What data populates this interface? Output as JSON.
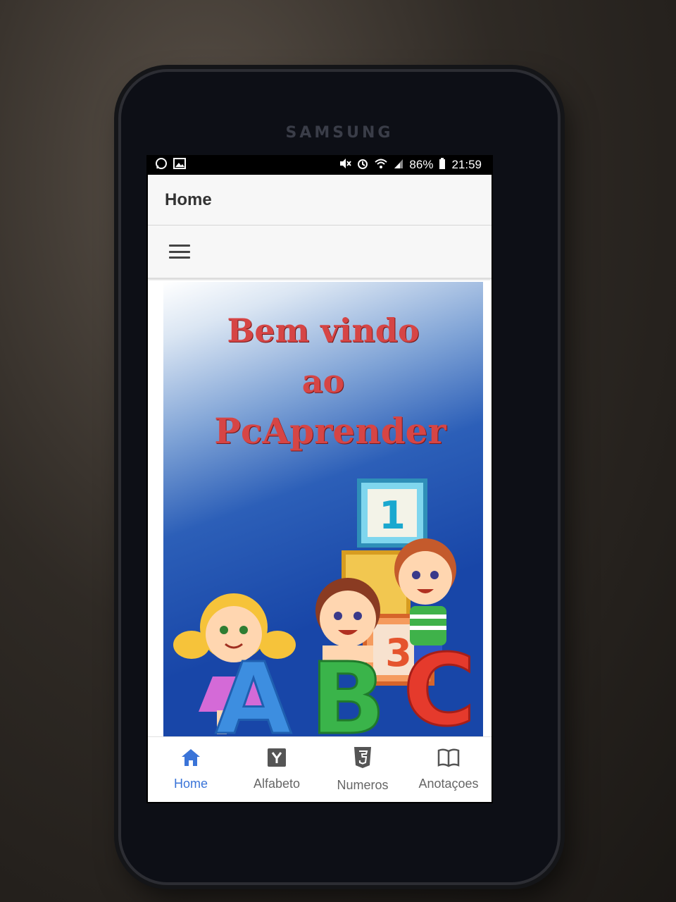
{
  "device": {
    "brand": "SAMSUNG"
  },
  "statusbar": {
    "battery": "86%",
    "time": "21:59"
  },
  "appbar": {
    "title": "Home"
  },
  "banner": {
    "line1": "Bem vindo",
    "line2": "ao",
    "line3": "PcAprender",
    "block_number_1": "1",
    "block_number_3": "3",
    "letters": [
      "A",
      "B",
      "C"
    ]
  },
  "bottom_nav": {
    "items": [
      {
        "label": "Home",
        "icon": "home-icon",
        "active": true
      },
      {
        "label": "Alfabeto",
        "icon": "y-square-icon",
        "active": false
      },
      {
        "label": "Numeros",
        "icon": "html5-shield-icon",
        "active": false
      },
      {
        "label": "Anotaçoes",
        "icon": "open-book-icon",
        "active": false
      }
    ]
  },
  "colors": {
    "accent": "#3a74d8",
    "title_red": "#d64545",
    "banner_blue": "#1846a8"
  }
}
